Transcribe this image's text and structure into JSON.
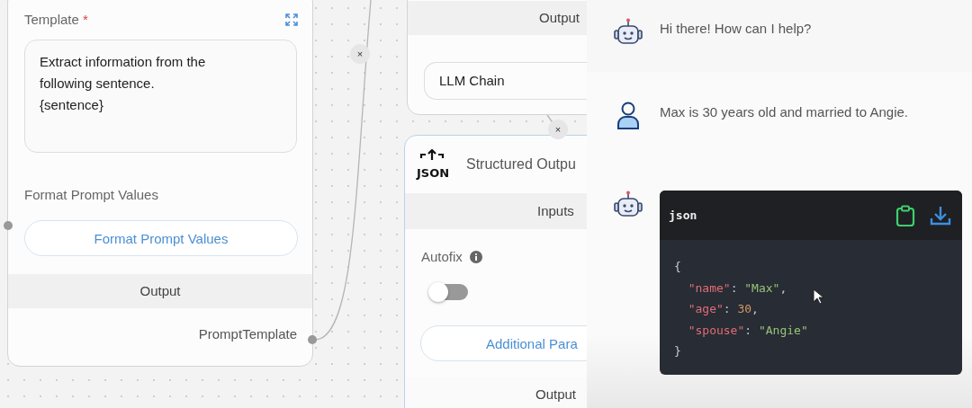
{
  "canvas": {
    "nodes": [
      {
        "kind": "prompt",
        "template_label": "Template",
        "required_mark": "*",
        "template_value": "Extract information from the\nfollowing sentence.\n{sentence}",
        "format_label": "Format Prompt Values",
        "format_button": "Format Prompt Values",
        "output_header": "Output",
        "output_handle": "PromptTemplate"
      },
      {
        "kind": "chain",
        "output_header": "Output",
        "field_value": "LLM Chain"
      },
      {
        "kind": "parser",
        "icon_text": "JSON",
        "title": "Structured Outpu",
        "inputs_header": "Inputs",
        "autofix_label": "Autofix",
        "autofix_toggle": {
          "on": false
        },
        "params_button": "Additional Para",
        "output_header": "Output"
      }
    ],
    "edge_delete_marks": [
      "×",
      "×"
    ]
  },
  "chat": {
    "messages": [
      {
        "kind": "bot",
        "text": "Hi there! How can I help?"
      },
      {
        "kind": "user",
        "text": "Max is 30 years old and married to Angie."
      },
      {
        "kind": "bot",
        "code": {
          "language": "json",
          "lines": [
            {
              "tokens": [
                {
                  "kind": "punct",
                  "text": "{"
                }
              ]
            },
            {
              "tokens": [
                {
                  "kind": "key",
                  "text": "  \"name\""
                },
                {
                  "kind": "punct",
                  "text": ": "
                },
                {
                  "kind": "string",
                  "text": "\"Max\""
                },
                {
                  "kind": "punct",
                  "text": ","
                }
              ]
            },
            {
              "tokens": [
                {
                  "kind": "key",
                  "text": "  \"age\""
                },
                {
                  "kind": "punct",
                  "text": ": "
                },
                {
                  "kind": "number",
                  "text": "30"
                },
                {
                  "kind": "punct",
                  "text": ","
                }
              ]
            },
            {
              "tokens": [
                {
                  "kind": "key",
                  "text": "  \"spouse\""
                },
                {
                  "kind": "punct",
                  "text": ": "
                },
                {
                  "kind": "string",
                  "text": "\"Angie\""
                }
              ]
            },
            {
              "tokens": [
                {
                  "kind": "punct",
                  "text": "}"
                }
              ]
            }
          ]
        }
      }
    ]
  }
}
